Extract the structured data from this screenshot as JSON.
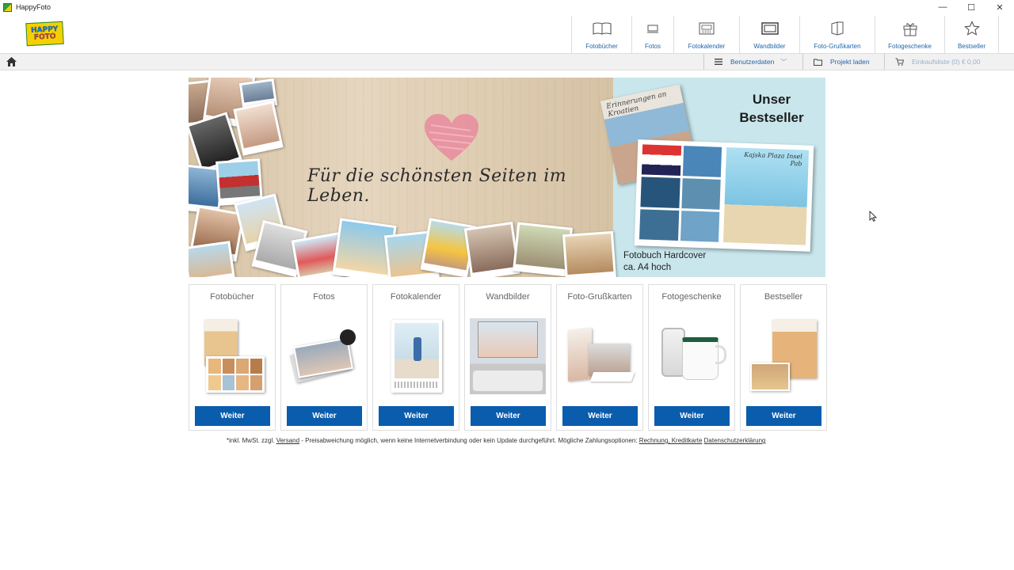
{
  "window": {
    "title": "HappyFoto",
    "controls": [
      "—",
      "☐",
      "✕"
    ]
  },
  "logo": {
    "line1": "HAPPY",
    "line2": "FOTO"
  },
  "topnav": [
    {
      "label": "Fotobücher",
      "icon": "book-icon"
    },
    {
      "label": "Fotos",
      "icon": "photos-icon"
    },
    {
      "label": "Fotokalender",
      "icon": "calendar-icon"
    },
    {
      "label": "Wandbilder",
      "icon": "wall-picture-icon"
    },
    {
      "label": "Foto-Grußkarten",
      "icon": "greeting-card-icon"
    },
    {
      "label": "Fotogeschenke",
      "icon": "gift-icon"
    },
    {
      "label": "Bestseller",
      "icon": "star-icon"
    }
  ],
  "toolbar": {
    "user_data": "Benutzerdaten",
    "load_project": "Projekt laden",
    "cart": "Einkaufsliste (0) € 0,00"
  },
  "banner": {
    "tagline": "Für die schönsten Seiten im Leben.",
    "headline_1": "Unser",
    "headline_2": "Bestseller",
    "caption_1": "Fotobuch Hardcover",
    "caption_2": "ca. A4 hoch",
    "book_cover_text": "Erinnerungen an Kroatien",
    "book_page_text": "Kajska Plaza Insel Pab"
  },
  "cards": [
    {
      "title": "Fotobücher",
      "button": "Weiter"
    },
    {
      "title": "Fotos",
      "button": "Weiter"
    },
    {
      "title": "Fotokalender",
      "button": "Weiter"
    },
    {
      "title": "Wandbilder",
      "button": "Weiter"
    },
    {
      "title": "Foto-Grußkarten",
      "button": "Weiter"
    },
    {
      "title": "Fotogeschenke",
      "button": "Weiter"
    },
    {
      "title": "Bestseller",
      "button": "Weiter"
    }
  ],
  "footnote": {
    "prefix": "*inkl. MwSt. zzgl.",
    "shipping_link": "Versand",
    "middle": "- Preisabweichung möglich, wenn keine Internetverbindung oder kein Update durchgeführt. Mögliche Zahlungsoptionen:",
    "payment_link": "Rechnung, Kreditkarte",
    "privacy_link": "Datenschutzerklärung"
  },
  "colors": {
    "accent": "#0a5cad",
    "link": "#2266aa",
    "banner_blue": "#c8e6ec"
  }
}
